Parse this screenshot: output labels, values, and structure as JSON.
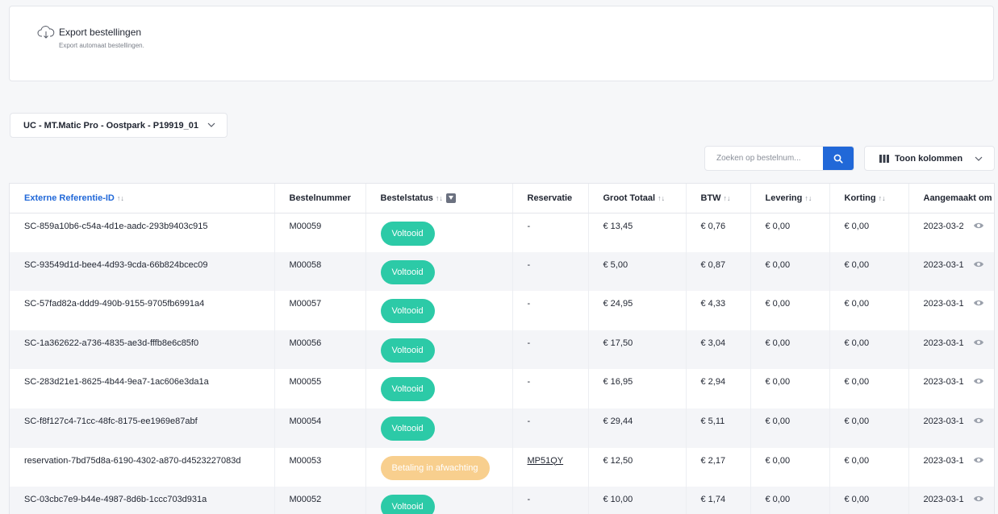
{
  "export": {
    "title": "Export bestellingen",
    "subtitle": "Export automaat bestellingen.",
    "icon": "cloud-download-icon"
  },
  "location_select": {
    "value": "UC - MT.Matic Pro - Oostpark - P19919_01"
  },
  "search": {
    "placeholder": "Zoeken op bestelnum...",
    "value": ""
  },
  "columns_button": {
    "label": "Toon kolommen"
  },
  "colors": {
    "accent": "#2168d8",
    "success": "#2ccaa7",
    "pending": "#f8cf8e"
  },
  "table": {
    "columns": [
      {
        "label": "Externe Referentie-ID",
        "sort": "↑↓",
        "active": true
      },
      {
        "label": "Bestelnummer",
        "sort": ""
      },
      {
        "label": "Bestelstatus",
        "sort": "↑↓",
        "filter": true
      },
      {
        "label": "Reservatie",
        "sort": ""
      },
      {
        "label": "Groot Totaal",
        "sort": "↑↓"
      },
      {
        "label": "BTW",
        "sort": "↑↓"
      },
      {
        "label": "Levering",
        "sort": "↑↓"
      },
      {
        "label": "Korting",
        "sort": "↑↓"
      },
      {
        "label": "Aangemaakt om",
        "sort": ""
      }
    ],
    "rows": [
      {
        "ref": "SC-859a10b6-c54a-4d1e-aadc-293b9403c915",
        "order": "M00059",
        "status": "Voltooid",
        "status_type": "green",
        "reservation": "-",
        "total": "€ 13,45",
        "vat": "€ 0,76",
        "delivery": "€ 0,00",
        "discount": "€ 0,00",
        "created": "2023-03-2"
      },
      {
        "ref": "SC-93549d1d-bee4-4d93-9cda-66b824bcec09",
        "order": "M00058",
        "status": "Voltooid",
        "status_type": "green",
        "reservation": "-",
        "total": "€ 5,00",
        "vat": "€ 0,87",
        "delivery": "€ 0,00",
        "discount": "€ 0,00",
        "created": "2023-03-1"
      },
      {
        "ref": "SC-57fad82a-ddd9-490b-9155-9705fb6991a4",
        "order": "M00057",
        "status": "Voltooid",
        "status_type": "green",
        "reservation": "-",
        "total": "€ 24,95",
        "vat": "€ 4,33",
        "delivery": "€ 0,00",
        "discount": "€ 0,00",
        "created": "2023-03-1"
      },
      {
        "ref": "SC-1a362622-a736-4835-ae3d-fffb8e6c85f0",
        "order": "M00056",
        "status": "Voltooid",
        "status_type": "green",
        "reservation": "-",
        "total": "€ 17,50",
        "vat": "€ 3,04",
        "delivery": "€ 0,00",
        "discount": "€ 0,00",
        "created": "2023-03-1"
      },
      {
        "ref": "SC-283d21e1-8625-4b44-9ea7-1ac606e3da1a",
        "order": "M00055",
        "status": "Voltooid",
        "status_type": "green",
        "reservation": "-",
        "total": "€ 16,95",
        "vat": "€ 2,94",
        "delivery": "€ 0,00",
        "discount": "€ 0,00",
        "created": "2023-03-1"
      },
      {
        "ref": "SC-f8f127c4-71cc-48fc-8175-ee1969e87abf",
        "order": "M00054",
        "status": "Voltooid",
        "status_type": "green",
        "reservation": "-",
        "total": "€ 29,44",
        "vat": "€ 5,11",
        "delivery": "€ 0,00",
        "discount": "€ 0,00",
        "created": "2023-03-1"
      },
      {
        "ref": "reservation-7bd75d8a-6190-4302-a870-d4523227083d",
        "order": "M00053",
        "status": "Betaling in afwachting",
        "status_type": "orange",
        "reservation": "MP51QY",
        "reservation_link": true,
        "total": "€ 12,50",
        "vat": "€ 2,17",
        "delivery": "€ 0,00",
        "discount": "€ 0,00",
        "created": "2023-03-1"
      },
      {
        "ref": "SC-03cbc7e9-b44e-4987-8d6b-1ccc703d931a",
        "order": "M00052",
        "status": "Voltooid",
        "status_type": "green",
        "reservation": "-",
        "total": "€ 10,00",
        "vat": "€ 1,74",
        "delivery": "€ 0,00",
        "discount": "€ 0,00",
        "created": "2023-03-1"
      }
    ]
  }
}
